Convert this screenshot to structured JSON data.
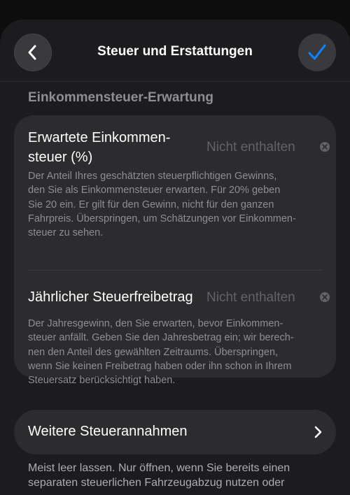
{
  "header": {
    "title": "Steuer und Erstattungen",
    "back_icon": "chevron-left-icon",
    "confirm_icon": "checkmark-icon",
    "accent_color": "#0a84ff"
  },
  "section": {
    "title": "Einkommensteuer-Erwartung"
  },
  "fields": [
    {
      "label_line1": "Erwartete Einkommen-",
      "label_line2": "steuer (%)",
      "value": "Nicht enthalten",
      "description_lines": [
        "Der Anteil Ihres geschätzten steuerpflichtigen Gewinns,",
        "den Sie als Einkommensteuer erwarten. Für 20% geben",
        "Sie 20 ein. Er gilt für den Gewinn, nicht für den ganzen",
        "Fahrpreis. Überspringen, um Schätzungen vor Einkommen-",
        "steuer zu sehen."
      ]
    },
    {
      "label": "Jährlicher Steuerfreibetrag",
      "value": "Nicht enthalten",
      "description_lines": [
        "Der Jahresgewinn, den Sie erwarten, bevor Einkommen-",
        "steuer anfällt. Geben Sie den Jahresbetrag ein; wir berech-",
        "nen den Anteil des gewählten Zeitraums. Überspringen,",
        "wenn Sie keinen Freibetrag haben oder ihn schon in Ihrem",
        "Steuersatz berücksichtigt haben."
      ]
    }
  ],
  "more": {
    "label": "Weitere Steuerannahmen",
    "icon": "chevron-right-icon",
    "description_lines": [
      "Meist leer lassen. Nur öffnen, wenn Sie bereits einen",
      "separaten steuerlichen Fahrzeugabzug nutzen oder"
    ]
  }
}
